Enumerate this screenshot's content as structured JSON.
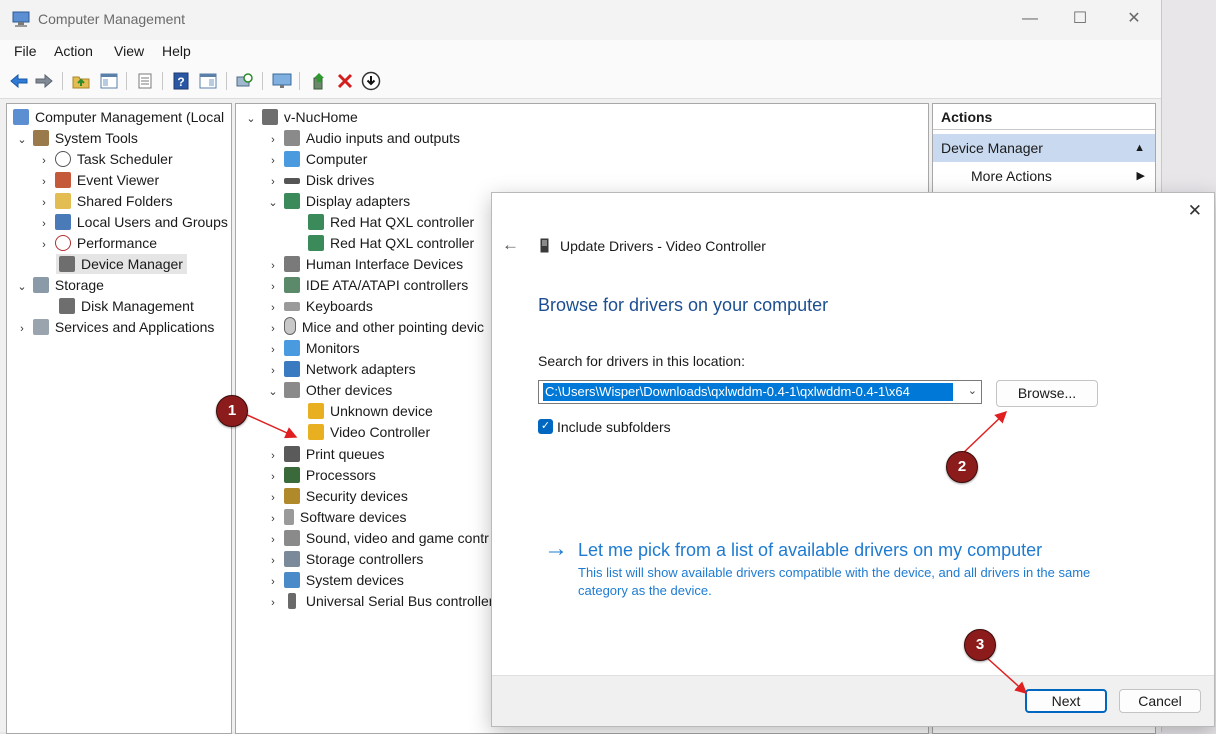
{
  "window": {
    "title": "Computer Management"
  },
  "menu": [
    "File",
    "Action",
    "View",
    "Help"
  ],
  "left_tree": [
    {
      "label": "Computer Management (Local",
      "icon": "computer-management-icon"
    },
    {
      "label": "System Tools",
      "icon": "tools-icon"
    },
    {
      "label": "Task Scheduler",
      "icon": "clock-icon"
    },
    {
      "label": "Event Viewer",
      "icon": "event-viewer-icon"
    },
    {
      "label": "Shared Folders",
      "icon": "shared-folder-icon"
    },
    {
      "label": "Local Users and Groups",
      "icon": "users-icon"
    },
    {
      "label": "Performance",
      "icon": "performance-icon"
    },
    {
      "label": "Device Manager",
      "icon": "device-manager-icon"
    },
    {
      "label": "Storage",
      "icon": "storage-icon"
    },
    {
      "label": "Disk Management",
      "icon": "disk-icon"
    },
    {
      "label": "Services and Applications",
      "icon": "services-icon"
    }
  ],
  "device_tree": [
    {
      "label": "v-NucHome",
      "icon": "computer-icon"
    },
    {
      "label": "Audio inputs and outputs",
      "icon": "speaker-icon"
    },
    {
      "label": "Computer",
      "icon": "monitor-icon"
    },
    {
      "label": "Disk drives",
      "icon": "disk-drive-icon"
    },
    {
      "label": "Display adapters",
      "icon": "display-adapter-icon"
    },
    {
      "label": "Red Hat QXL controller",
      "icon": "display-adapter-icon"
    },
    {
      "label": "Red Hat QXL controller",
      "icon": "display-adapter-icon"
    },
    {
      "label": "Human Interface Devices",
      "icon": "hid-icon"
    },
    {
      "label": "IDE ATA/ATAPI controllers",
      "icon": "ide-icon"
    },
    {
      "label": "Keyboards",
      "icon": "keyboard-icon"
    },
    {
      "label": "Mice and other pointing devic",
      "icon": "mouse-icon"
    },
    {
      "label": "Monitors",
      "icon": "monitor-icon"
    },
    {
      "label": "Network adapters",
      "icon": "network-icon"
    },
    {
      "label": "Other devices",
      "icon": "unknown-device-icon"
    },
    {
      "label": "Unknown device",
      "icon": "warning-device-icon"
    },
    {
      "label": "Video Controller",
      "icon": "warning-device-icon"
    },
    {
      "label": "Print queues",
      "icon": "printer-icon"
    },
    {
      "label": "Processors",
      "icon": "processor-icon"
    },
    {
      "label": "Security devices",
      "icon": "security-icon"
    },
    {
      "label": "Software devices",
      "icon": "software-device-icon"
    },
    {
      "label": "Sound, video and game contr",
      "icon": "sound-icon"
    },
    {
      "label": "Storage controllers",
      "icon": "storage-controller-icon"
    },
    {
      "label": "System devices",
      "icon": "system-devices-icon"
    },
    {
      "label": "Universal Serial Bus controller",
      "icon": "usb-icon"
    }
  ],
  "actions": {
    "header": "Actions",
    "section": "Device Manager",
    "more": "More Actions"
  },
  "dialog": {
    "title": "Update Drivers - Video Controller",
    "heading": "Browse for drivers on your computer",
    "search_label": "Search for drivers in this location:",
    "path_value": "C:\\Users\\Wisper\\Downloads\\qxlwddm-0.4-1\\qxlwddm-0.4-1\\x64",
    "browse_label": "Browse...",
    "include_subfolders": "Include subfolders",
    "include_subfolders_checked": true,
    "pick_link": "Let me pick from a list of available drivers on my computer",
    "pick_desc": "This list will show available drivers compatible with the device, and all drivers in the same category as the device.",
    "next_label": "Next",
    "cancel_label": "Cancel"
  },
  "annotations": [
    "1",
    "2",
    "3"
  ],
  "colors": {
    "accent": "#0067c0",
    "link": "#1e7bd1",
    "heading": "#1c4f91",
    "badge": "#8c1c1c",
    "arrow": "#e02020"
  }
}
